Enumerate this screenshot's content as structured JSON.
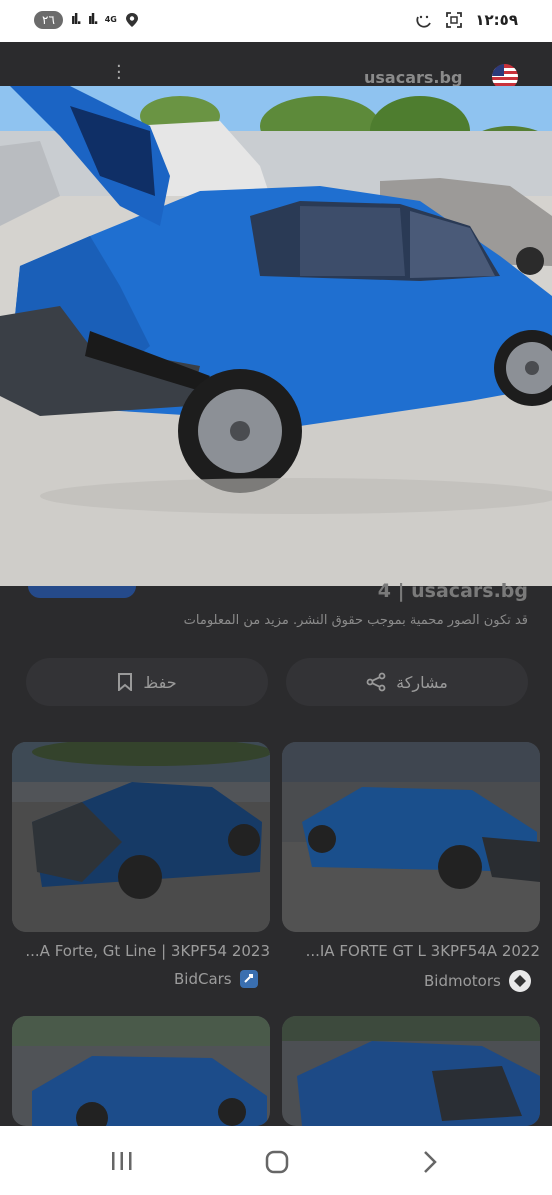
{
  "status": {
    "badge": "٢٦",
    "network": "4G",
    "time": "١٢:٥٩"
  },
  "header": {
    "site": "usacars.bg"
  },
  "image_meta": {
    "caption": "4 | usacars.bg",
    "notice": "قد تكون الصور محمية بموجب حقوق النشر. مزيد من المعلومات"
  },
  "actions": {
    "save_label": "حفظ",
    "share_label": "مشاركة"
  },
  "results": [
    {
      "title": "...A Forte, Gt Line | 3KPF54 2023",
      "source": "BidCars"
    },
    {
      "title": "...IA FORTE GT L 3KPF54A 2022",
      "source": "Bidmotors"
    }
  ],
  "colors": {
    "car_blue": "#1f6fd0",
    "sky": "#8fc3f0",
    "ground": "#d5d3cf"
  }
}
